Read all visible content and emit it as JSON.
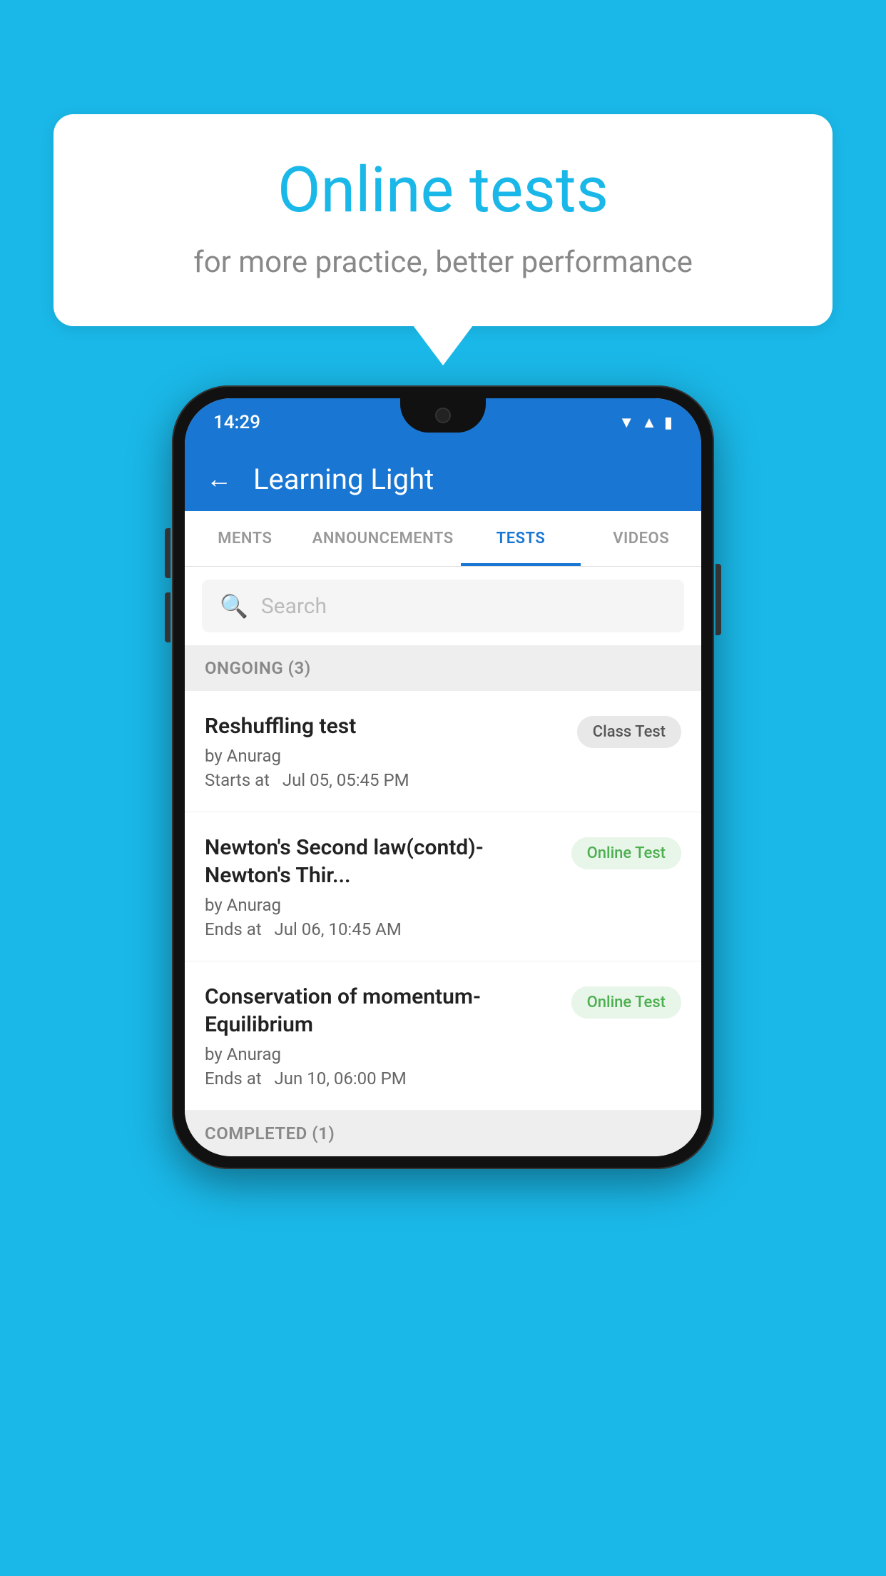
{
  "background": {
    "color": "#1ab8e8"
  },
  "bubble": {
    "title": "Online tests",
    "subtitle": "for more practice, better performance"
  },
  "phone": {
    "status_bar": {
      "time": "14:29",
      "icons": [
        "wifi",
        "signal",
        "battery"
      ]
    },
    "app_header": {
      "title": "Learning Light",
      "back_label": "←"
    },
    "tabs": [
      {
        "label": "MENTS",
        "active": false
      },
      {
        "label": "ANNOUNCEMENTS",
        "active": false
      },
      {
        "label": "TESTS",
        "active": true
      },
      {
        "label": "VIDEOS",
        "active": false
      }
    ],
    "search": {
      "placeholder": "Search"
    },
    "ongoing_section": {
      "label": "ONGOING (3)"
    },
    "tests": [
      {
        "name": "Reshuffling test",
        "author": "by Anurag",
        "date": "Starts at  Jul 05, 05:45 PM",
        "badge": "Class Test",
        "badge_type": "class"
      },
      {
        "name": "Newton's Second law(contd)-Newton's Thir...",
        "author": "by Anurag",
        "date": "Ends at  Jul 06, 10:45 AM",
        "badge": "Online Test",
        "badge_type": "online"
      },
      {
        "name": "Conservation of momentum-Equilibrium",
        "author": "by Anurag",
        "date": "Ends at  Jun 10, 06:00 PM",
        "badge": "Online Test",
        "badge_type": "online"
      }
    ],
    "completed_section": {
      "label": "COMPLETED (1)"
    }
  }
}
